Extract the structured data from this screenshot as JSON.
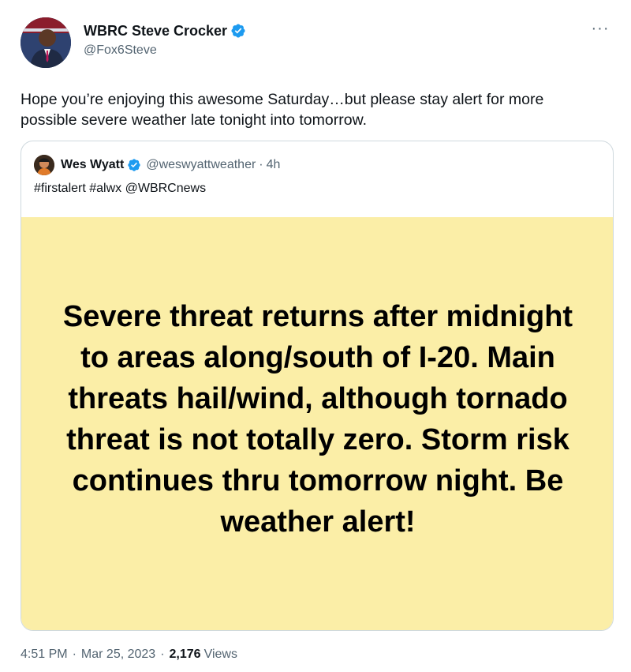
{
  "author": {
    "display_name": "WBRC Steve Crocker",
    "handle": "@Fox6Steve",
    "verified_icon": "verified-badge-icon",
    "avatar_icon": "profile-avatar"
  },
  "more_icon": "more-options-icon",
  "tweet": {
    "text": "Hope you’re enjoying this awesome Saturday…but please stay alert for more possible severe weather late tonight into tomorrow."
  },
  "quote": {
    "display_name": "Wes Wyatt",
    "handle": "@weswyattweather",
    "separator": "·",
    "time": "4h",
    "text": "#firstalert #alwx @WBRCnews",
    "image_text": "Severe threat returns after midnight to areas along/south of I-20. Main threats hail/wind, although tornado threat is not totally zero. Storm risk continues thru tomorrow night. Be weather alert!",
    "image_background": "#fbeea7"
  },
  "meta": {
    "time": "4:51 PM",
    "separator": "·",
    "date": "Mar 25, 2023",
    "separator2": "·",
    "views_count": "2,176",
    "views_label": "Views"
  },
  "colors": {
    "verified": "#1d9bf0",
    "secondary_text": "#536471",
    "primary_text": "#0f1419"
  }
}
